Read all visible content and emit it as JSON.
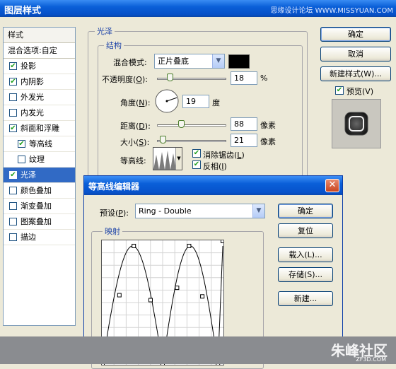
{
  "window": {
    "title": "图层样式",
    "watermark": "思缘设计论坛 WWW.MISSYUAN.COM"
  },
  "style_list": {
    "header": "样式",
    "blend_options": "混合选项:自定",
    "items": [
      {
        "label": "投影",
        "checked": true,
        "sub": false,
        "selected": false
      },
      {
        "label": "内阴影",
        "checked": true,
        "sub": false,
        "selected": false
      },
      {
        "label": "外发光",
        "checked": false,
        "sub": false,
        "selected": false
      },
      {
        "label": "内发光",
        "checked": false,
        "sub": false,
        "selected": false
      },
      {
        "label": "斜面和浮雕",
        "checked": true,
        "sub": false,
        "selected": false
      },
      {
        "label": "等高线",
        "checked": true,
        "sub": true,
        "selected": false
      },
      {
        "label": "纹理",
        "checked": false,
        "sub": true,
        "selected": false
      },
      {
        "label": "光泽",
        "checked": true,
        "sub": false,
        "selected": true
      },
      {
        "label": "颜色叠加",
        "checked": false,
        "sub": false,
        "selected": false
      },
      {
        "label": "渐变叠加",
        "checked": false,
        "sub": false,
        "selected": false
      },
      {
        "label": "图案叠加",
        "checked": false,
        "sub": false,
        "selected": false
      },
      {
        "label": "描边",
        "checked": false,
        "sub": false,
        "selected": false
      }
    ]
  },
  "satin": {
    "group_title": "光泽",
    "structure_title": "结构",
    "blend_mode_label": "混合模式:",
    "blend_mode_value": "正片叠底",
    "blend_color": "#000000",
    "opacity_label": "不透明度(",
    "opacity_key": "O",
    "opacity_suffix": "):",
    "opacity_value": "18",
    "opacity_unit": "%",
    "opacity_level": 0.18,
    "angle_label": "角度(",
    "angle_key": "N",
    "angle_suffix": "):",
    "angle_value": "19",
    "angle_unit": "度",
    "distance_label": "距离(",
    "distance_key": "D",
    "distance_suffix": "):",
    "distance_value": "88",
    "distance_unit": "像素",
    "distance_level": 0.35,
    "size_label": "大小(",
    "size_key": "S",
    "size_suffix": "):",
    "size_value": "21",
    "size_unit": "像素",
    "size_level": 0.084,
    "contour_label": "等高线:",
    "antialias_label": "消除锯齿(",
    "antialias_key": "L",
    "antialias_suffix": ")",
    "antialias_checked": true,
    "invert_label": "反相(",
    "invert_key": "I",
    "invert_suffix": ")",
    "invert_checked": true
  },
  "right_panel": {
    "ok": "确定",
    "cancel": "取消",
    "new_style": "新建样式(W)...",
    "preview_label": "预览(V)",
    "preview_checked": true
  },
  "contour_editor": {
    "title": "等高线编辑器",
    "preset_label": "预设(",
    "preset_key": "P",
    "preset_suffix": "):",
    "preset_value": "Ring - Double",
    "mapping_label": "映射",
    "ok": "确定",
    "reset": "复位",
    "load": "载入(L)...",
    "save": "存储(S)...",
    "new": "新建..."
  },
  "footer": {
    "logo": "朱峰社区",
    "site": "ZF3D.COM"
  }
}
